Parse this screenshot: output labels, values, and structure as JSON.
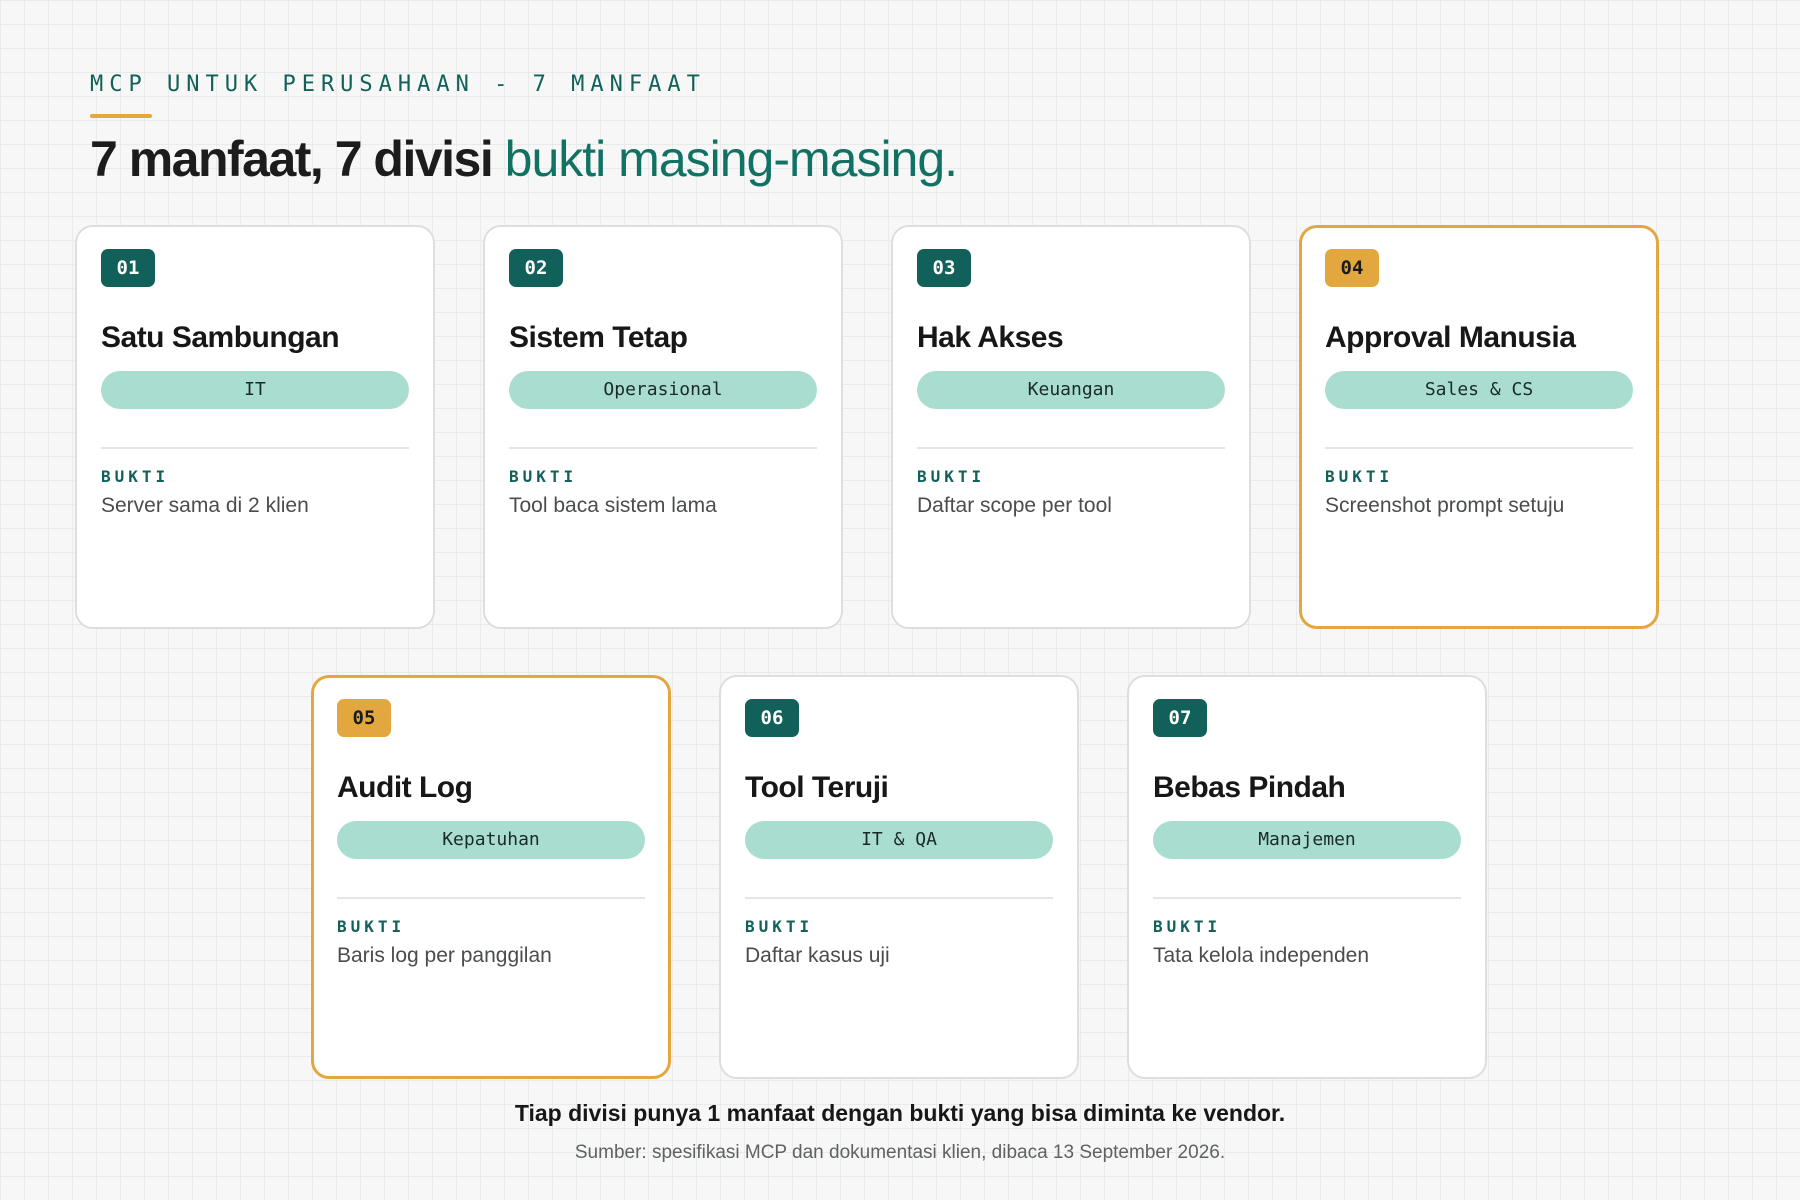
{
  "header": {
    "eyebrow": "MCP UNTUK PERUSAHAAN - 7 MANFAAT",
    "headline_main": "7 manfaat, 7 divisi",
    "headline_accent": "bukti masing-masing."
  },
  "proof_label": "BUKTI",
  "cards": [
    {
      "number": "01",
      "title": "Satu Sambungan",
      "division": "IT",
      "proof": "Server sama di 2 klien",
      "highlight": false
    },
    {
      "number": "02",
      "title": "Sistem Tetap",
      "division": "Operasional",
      "proof": "Tool baca sistem lama",
      "highlight": false
    },
    {
      "number": "03",
      "title": "Hak Akses",
      "division": "Keuangan",
      "proof": "Daftar scope per tool",
      "highlight": false
    },
    {
      "number": "04",
      "title": "Approval Manusia",
      "division": "Sales & CS",
      "proof": "Screenshot prompt setuju",
      "highlight": true
    },
    {
      "number": "05",
      "title": "Audit Log",
      "division": "Kepatuhan",
      "proof": "Baris log per panggilan",
      "highlight": true
    },
    {
      "number": "06",
      "title": "Tool Teruji",
      "division": "IT & QA",
      "proof": "Daftar kasus uji",
      "highlight": false
    },
    {
      "number": "07",
      "title": "Bebas Pindah",
      "division": "Manajemen",
      "proof": "Tata kelola independen",
      "highlight": false
    }
  ],
  "colors": {
    "accent_teal": "#11615a",
    "highlight_gold": "#e3a73f",
    "pill_mint": "#a9ddd0"
  },
  "footer": {
    "summary": "Tiap divisi punya 1 manfaat dengan bukti yang bisa diminta ke vendor.",
    "source": "Sumber: spesifikasi MCP dan dokumentasi klien, dibaca 13 September 2026."
  }
}
